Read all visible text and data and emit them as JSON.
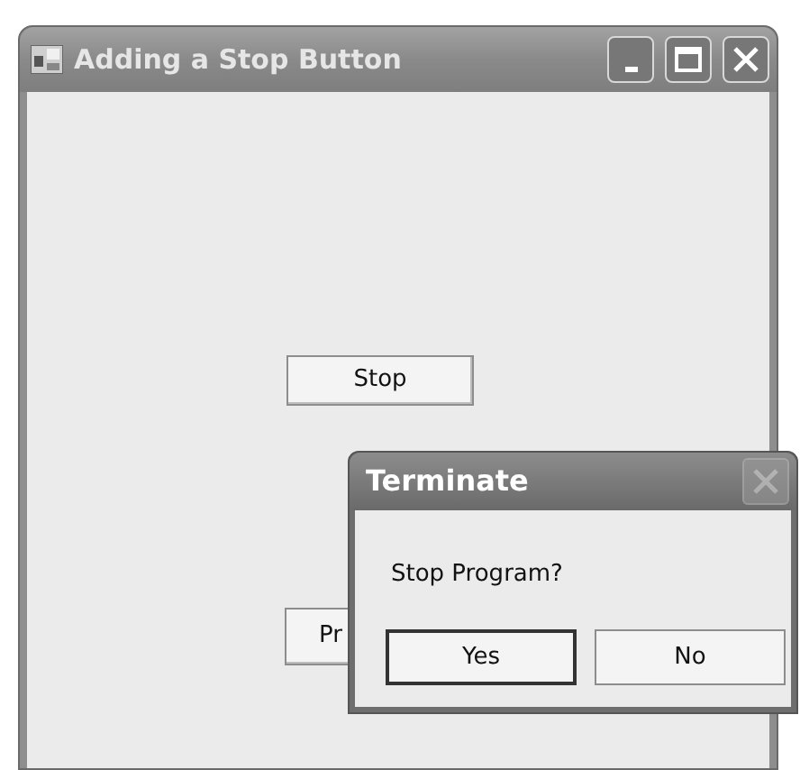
{
  "window": {
    "title": "Adding a Stop Button"
  },
  "form_buttons": [
    {
      "label": "Stop"
    },
    {
      "label": "Pr"
    }
  ],
  "dialog": {
    "title": "Terminate",
    "close_disabled": true,
    "message": "Stop Program?",
    "buttons": [
      {
        "label": "Yes",
        "default": true
      },
      {
        "label": "No",
        "default": false
      }
    ]
  }
}
